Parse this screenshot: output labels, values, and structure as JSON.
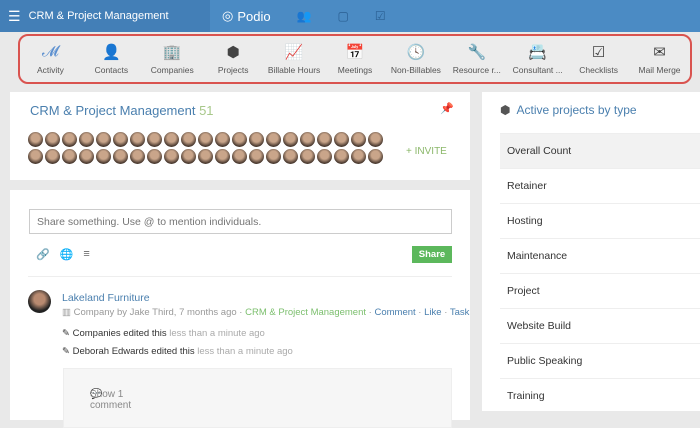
{
  "topbar": {
    "workspace": "CRM & Project Management",
    "brand": "Podio"
  },
  "toolbar": [
    {
      "label": "Activity",
      "icon": "activity-icon",
      "glyph": "𝓜"
    },
    {
      "label": "Contacts",
      "icon": "contacts-icon",
      "glyph": "👤"
    },
    {
      "label": "Companies",
      "icon": "companies-icon",
      "glyph": "🏢"
    },
    {
      "label": "Projects",
      "icon": "projects-icon",
      "glyph": "⬢"
    },
    {
      "label": "Billable Hours",
      "icon": "chart-icon",
      "glyph": "📈"
    },
    {
      "label": "Meetings",
      "icon": "calendar-icon",
      "glyph": "📅"
    },
    {
      "label": "Non-Billables",
      "icon": "clock-icon",
      "glyph": "🕓"
    },
    {
      "label": "Resource r...",
      "icon": "wrench-icon",
      "glyph": "🔧"
    },
    {
      "label": "Consultant ...",
      "icon": "contact-book-icon",
      "glyph": "📇"
    },
    {
      "label": "Checklists",
      "icon": "checkbox-icon",
      "glyph": "☑"
    },
    {
      "label": "Mail Merge",
      "icon": "mail-icon",
      "glyph": "✉"
    }
  ],
  "workspace_card": {
    "title": "CRM & Project Management",
    "member_count": "51",
    "invite": "+ INVITE"
  },
  "share": {
    "placeholder": "Share something. Use @ to mention individuals.",
    "button": "Share"
  },
  "feed": {
    "title": "Lakeland Furniture",
    "type": "Company",
    "by": "by",
    "author": "Jake Third, 7 months ago",
    "workspace": "CRM & Project Management",
    "actions": [
      "Comment",
      "Like",
      "Task"
    ],
    "edits": [
      {
        "who": "Companies edited this",
        "when": "less than a minute ago"
      },
      {
        "who": "Deborah Edwards edited this",
        "when": "less than a minute ago"
      }
    ],
    "show_comments": "Show 1 comment"
  },
  "right": {
    "title": "Active projects by type",
    "items": [
      "Overall Count",
      "Retainer",
      "Hosting",
      "Maintenance",
      "Project",
      "Website Build",
      "Public Speaking",
      "Training"
    ]
  }
}
